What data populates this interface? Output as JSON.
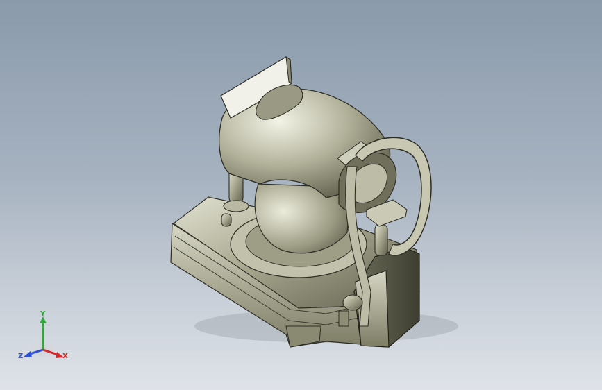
{
  "viewport": {
    "background_top": "#8a9aab",
    "background_bottom": "#dfe3e9",
    "model_color": "#b5b59f"
  },
  "triad": {
    "y_label": "Y",
    "x_label": "X",
    "z_label": "Z",
    "y_color": "#2ea836",
    "x_color": "#d6282a",
    "z_color": "#2b4fd6"
  }
}
